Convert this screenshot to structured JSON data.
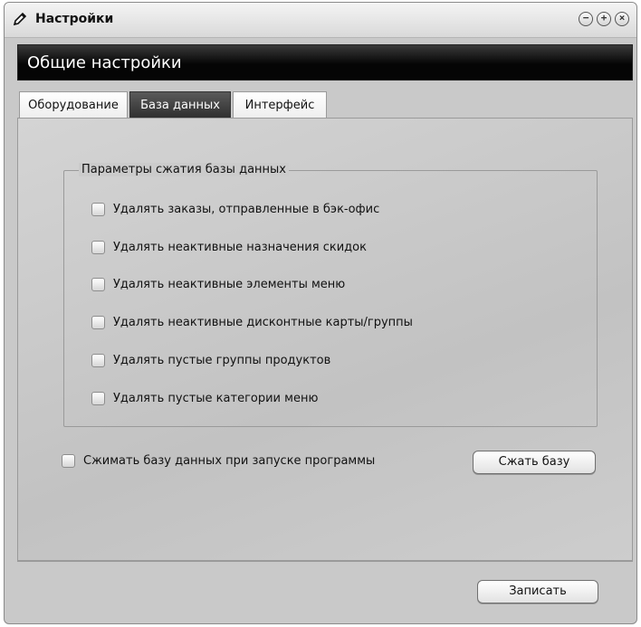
{
  "window": {
    "title": "Настройки",
    "controls": {
      "minimize": "−",
      "maximize": "+",
      "close": "×"
    }
  },
  "header": {
    "title": "Общие настройки"
  },
  "tabs": [
    {
      "label": "Оборудование",
      "active": false
    },
    {
      "label": "База данных",
      "active": true
    },
    {
      "label": "Интерфейс",
      "active": false
    }
  ],
  "compression": {
    "group_title": "Параметры сжатия базы данных",
    "options": [
      {
        "label": "Удалять заказы, отправленные в бэк-офис",
        "checked": false
      },
      {
        "label": "Удалять неактивные назначения скидок",
        "checked": false
      },
      {
        "label": "Удалять неактивные элементы меню",
        "checked": false
      },
      {
        "label": "Удалять неактивные дисконтные карты/группы",
        "checked": false
      },
      {
        "label": "Удалять пустые группы продуктов",
        "checked": false
      },
      {
        "label": "Удалять пустые категории меню",
        "checked": false
      }
    ],
    "compress_on_start": {
      "label": "Сжимать базу данных при запуске программы",
      "checked": false
    },
    "compress_button": "Сжать базу"
  },
  "footer": {
    "save_button": "Записать"
  }
}
